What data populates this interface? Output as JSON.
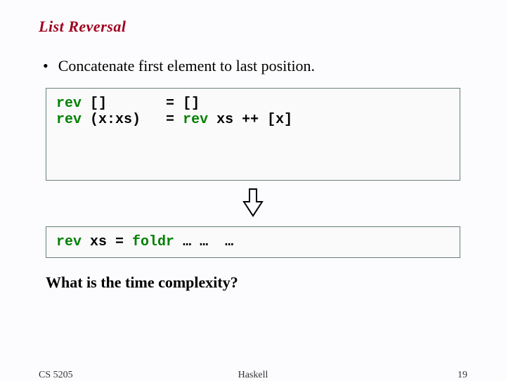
{
  "title": "List Reversal",
  "bullet": "Concatenate first element to last position.",
  "code1": {
    "p1a": "rev",
    "p1b": " []       ",
    "p1c": "= ",
    "p1d": "[]",
    "p2a": "rev",
    "p2b": " (x:xs)   ",
    "p2c": "= ",
    "p2d": "rev",
    "p2e": " xs ",
    "p2f": "++ ",
    "p2g": "[x]"
  },
  "code2": {
    "a": "rev",
    "b": " xs ",
    "c": "= ",
    "d": "foldr",
    "e": " … …  …"
  },
  "question": "What is the time complexity?",
  "footer": {
    "left": "CS 5205",
    "center": "Haskell",
    "right": "19"
  }
}
